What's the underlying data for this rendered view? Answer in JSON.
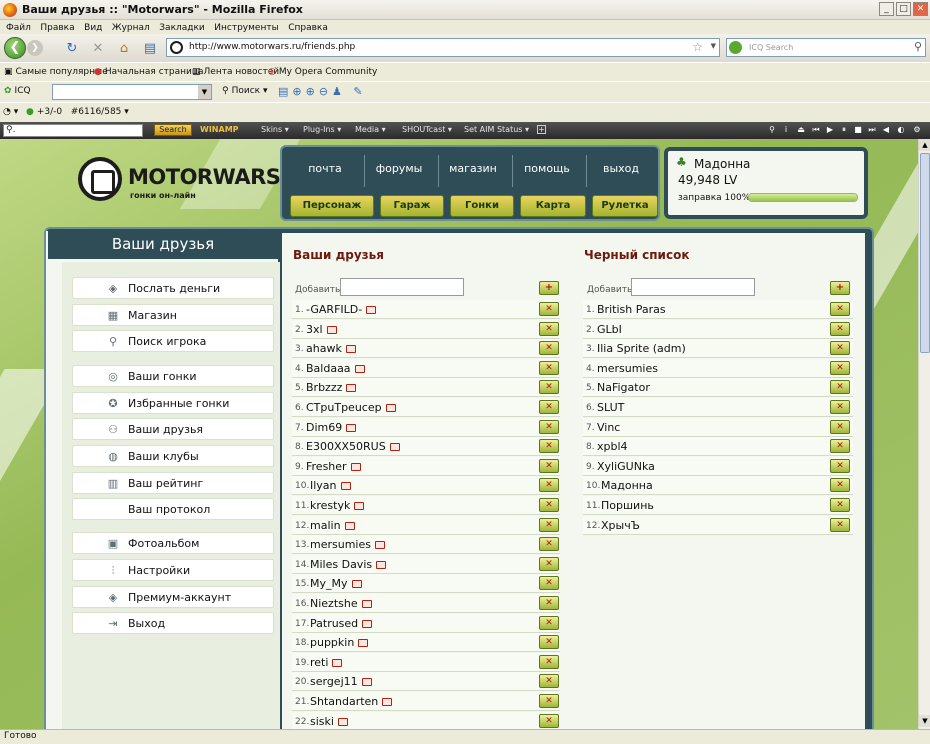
{
  "window": {
    "title": "Ваши друзья :: \"Motorwars\" - Mozilla Firefox"
  },
  "menu": [
    "Файл",
    "Правка",
    "Вид",
    "Журнал",
    "Закладки",
    "Инструменты",
    "Справка"
  ],
  "address": {
    "url": "http://www.motorwars.ru/friends.php",
    "search_placeholder": "ICQ Search"
  },
  "bookmarks": [
    "Самые популярные",
    "Начальная страница",
    "Лента новостей",
    "My Opera Community"
  ],
  "icq_toolbar": {
    "icq_label": "ICQ",
    "search_label": "Поиск"
  },
  "status_toolbar": {
    "counter": "+3/-0",
    "id": "#6116/585"
  },
  "winamp": {
    "search_button": "Search",
    "logo": "WINAMP",
    "skins": "Skins",
    "plugins": "Plug-Ins",
    "media": "Media",
    "shoutcast": "SHOUTcast",
    "aim": "Set AIM Status"
  },
  "site": {
    "logo": "MOTORWARS.RU",
    "logo_sub": "гонки он-лайн"
  },
  "topnav": {
    "links": [
      "почта",
      "форумы",
      "магазин",
      "помощь",
      "выход"
    ],
    "buttons": [
      "Персонаж",
      "Гараж",
      "Гонки",
      "Карта",
      "Рулетка"
    ]
  },
  "user": {
    "name": "Мадонна",
    "level": "49,948 LV",
    "fuel_label": "заправка 100%",
    "fuel": 1.0
  },
  "sidebar": {
    "title": "Ваши друзья",
    "items": [
      {
        "label": "Послать деньги",
        "icon": "money-icon"
      },
      {
        "label": "Магазин",
        "icon": "shop-icon"
      },
      {
        "label": "Поиск игрока",
        "icon": "magnifier-icon"
      },
      {
        "label": "Ваши гонки",
        "icon": "wheel-icon"
      },
      {
        "label": "Избранные гонки",
        "icon": "star-wheel-icon"
      },
      {
        "label": "Ваши друзья",
        "icon": "friends-icon"
      },
      {
        "label": "Ваши клубы",
        "icon": "clubs-icon"
      },
      {
        "label": "Ваш рейтинг",
        "icon": "rating-icon"
      },
      {
        "label": "Ваш протокол",
        "icon": ""
      },
      {
        "label": "Фотоальбом",
        "icon": "photo-icon"
      },
      {
        "label": "Настройки",
        "icon": "settings-icon"
      },
      {
        "label": "Премиум-аккаунт",
        "icon": "premium-icon"
      },
      {
        "label": "Выход",
        "icon": "exit-icon"
      }
    ]
  },
  "friends": {
    "title": "Ваши друзья",
    "add_label": "Добавить:",
    "add_value": "",
    "list": [
      "-GARFILD-",
      "3xl",
      "ahawk",
      "Baldaaa",
      "Brbzzz",
      "CTpuTpeucep",
      "Dim69",
      "E300XX50RUS",
      "Fresher",
      "Ilyan",
      "krestyk",
      "malin",
      "mersumies",
      "Miles Davis",
      "My_My",
      "Nieztshe",
      "Patrused",
      "puppkin",
      "reti",
      "sergej11",
      "Shtandarten",
      "siski"
    ]
  },
  "blacklist": {
    "title": "Черный список",
    "add_label": "Добавить:",
    "add_value": "",
    "list": [
      "British Paras",
      "GLbI",
      "Ilia Sprite (adm)",
      "mersumies",
      "NaFigator",
      "SLUT",
      "Vinc",
      "xpbl4",
      "XyliGUNka",
      "Мадонна",
      "Поршинь",
      "ХрычЪ"
    ]
  },
  "status": "Готово"
}
